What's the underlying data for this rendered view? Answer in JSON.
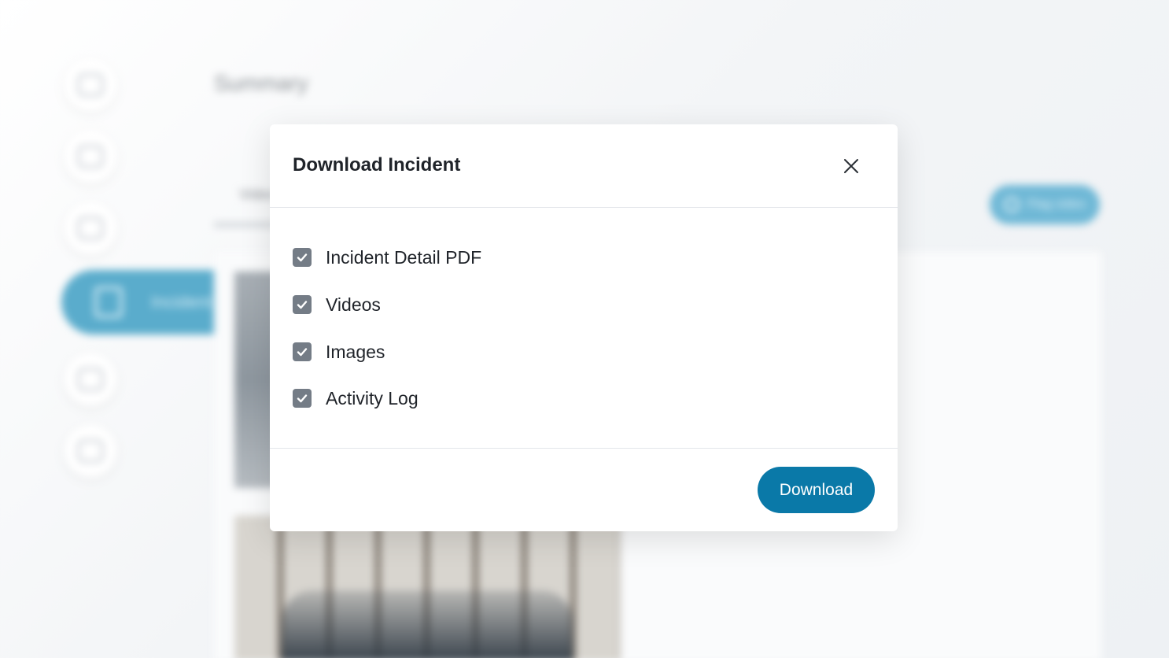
{
  "background": {
    "page_title": "Summary",
    "tab_label": "Video",
    "action_pill_label": "Flag video",
    "sidebar": {
      "items": [
        {
          "icon": "shield-icon"
        },
        {
          "icon": "camera-icon"
        },
        {
          "icon": "calendar-icon"
        },
        {
          "icon": "document-search-icon",
          "label": "Incident",
          "active": true
        },
        {
          "icon": "person-icon"
        },
        {
          "icon": "vehicle-icon"
        }
      ]
    }
  },
  "modal": {
    "title": "Download Incident",
    "close_icon": "close-icon",
    "options": [
      {
        "label": "Incident Detail PDF",
        "checked": true
      },
      {
        "label": "Videos",
        "checked": true
      },
      {
        "label": "Images",
        "checked": true
      },
      {
        "label": "Activity Log",
        "checked": true
      }
    ],
    "download_label": "Download"
  },
  "colors": {
    "primary_button": "#0a79a8",
    "checkbox_fill": "#747c86",
    "sidebar_active": "#5aaccc"
  }
}
